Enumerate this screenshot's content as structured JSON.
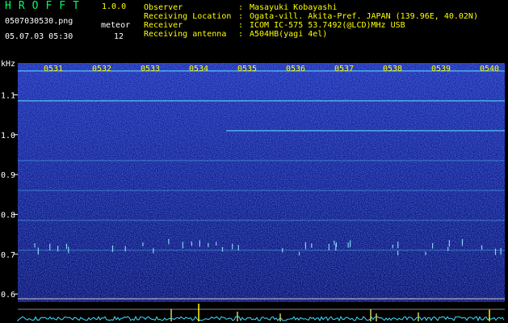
{
  "header": {
    "brand": "HROFFT",
    "version": "1.0.0",
    "filename": "0507030530.png",
    "meteor_label": "meteor",
    "datetime": "05.07.03 05:30",
    "meteor_count": "12"
  },
  "info": [
    {
      "key": "Observer",
      "value": "Masayuki Kobayashi"
    },
    {
      "key": "Receiving Location",
      "value": "Ogata-vill. Akita-Pref. JAPAN (139.96E, 40.02N)"
    },
    {
      "key": "Receiver",
      "value": "ICOM IC-575 53.7492(@LCD)MHz USB"
    },
    {
      "key": "Receiving antenna",
      "value": "A504HB(yagi 4el)"
    }
  ],
  "colors": {
    "background": "#000000",
    "spectrogram_base": "#0a1478",
    "label_yellow": "#ffff00",
    "brand_green": "#00ff66",
    "signal_cyan": "#40e0ff"
  },
  "chart_data": {
    "type": "heatmap",
    "ylabel": "kHz",
    "y_ticks": [
      "0.6",
      "0.7",
      "0.8",
      "0.9",
      "1.0",
      "1.1"
    ],
    "y_tick_values": [
      0.6,
      0.7,
      0.8,
      0.9,
      1.0,
      1.1
    ],
    "ylim": [
      0.58,
      1.18
    ],
    "x_time_labels": [
      "0531",
      "0532",
      "0533",
      "0534",
      "0535",
      "0536",
      "0537",
      "0538",
      "0539",
      "0540"
    ],
    "grid": false,
    "carrier_lines_khz": [
      1.16,
      1.085,
      1.01,
      0.935,
      0.86,
      0.785,
      0.71
    ]
  }
}
